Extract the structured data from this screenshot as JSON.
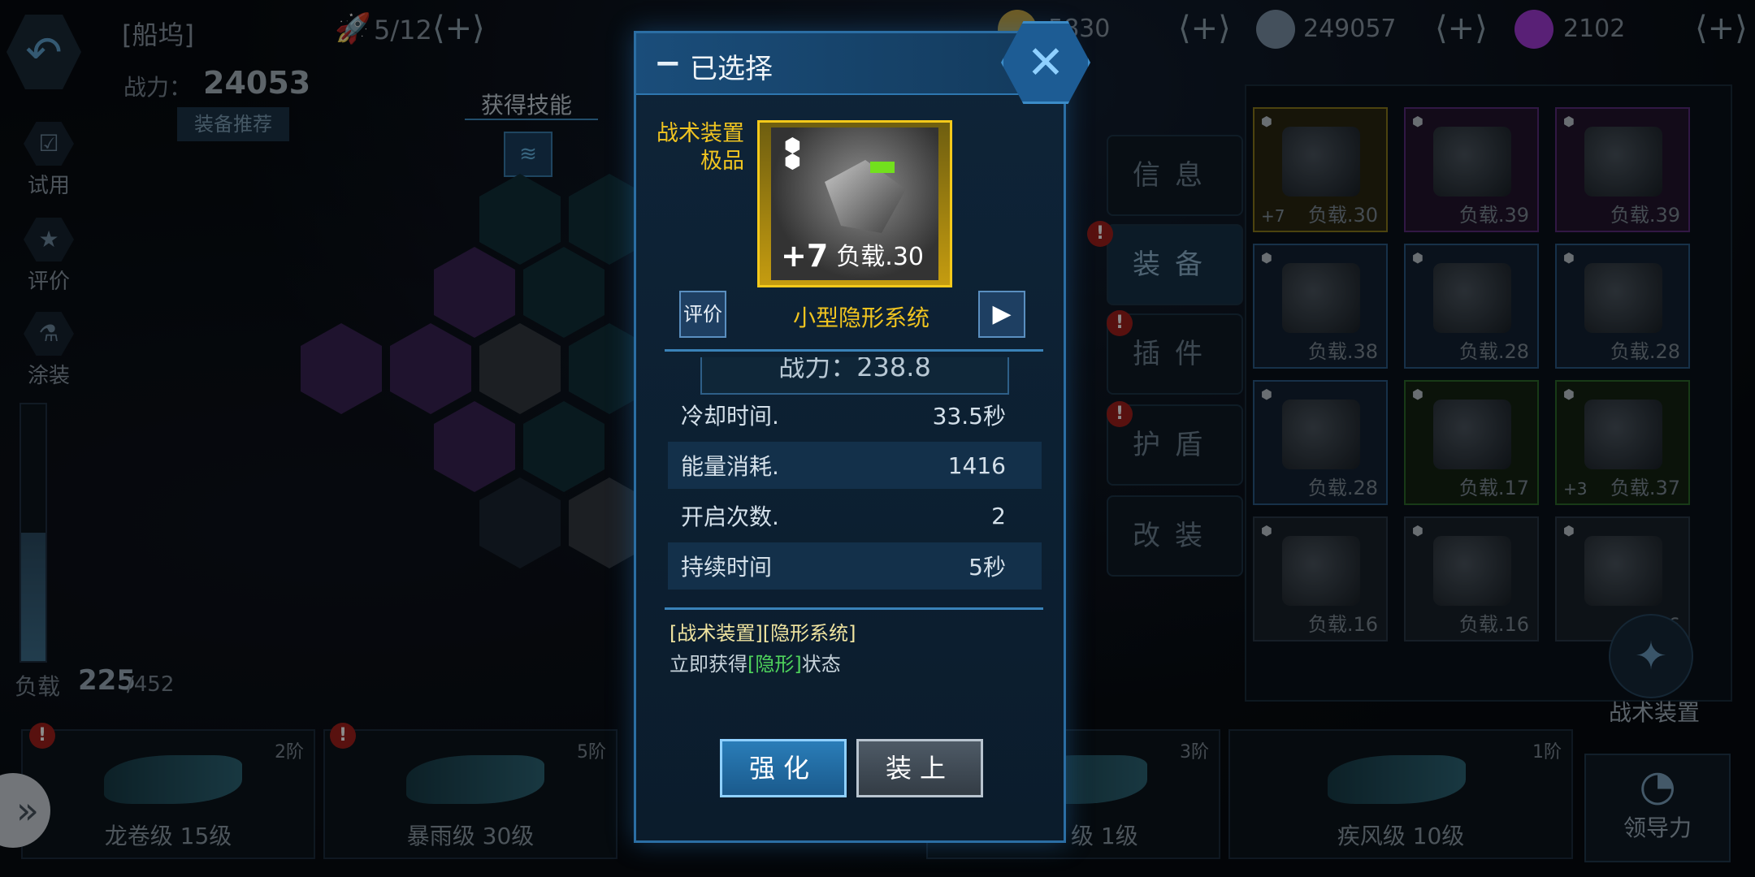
{
  "topbar": {
    "dock_title": "[船坞]",
    "slots": "5/12",
    "resources": [
      {
        "name": "credits",
        "value": "5830",
        "color": "#c9a640"
      },
      {
        "name": "alloy",
        "value": "249057",
        "color": "#7d93a8"
      },
      {
        "name": "crystal",
        "value": "2102",
        "color": "#a23bd8"
      }
    ]
  },
  "left": {
    "power_label": "战力：",
    "power_value": "24053",
    "recommend_label": "装备推荐",
    "side_items": [
      "试用",
      "评价",
      "涂装"
    ],
    "load_label": "负载",
    "load_value": "225",
    "load_max": "/452",
    "load_fraction": 0.5,
    "skill_label": "获得技能"
  },
  "modal": {
    "title": "已选择",
    "item_grade_line1": "战术装置",
    "item_grade_line2": "极品",
    "item_enhance": "+7",
    "item_load": "负载.30",
    "rate_label": "评价",
    "item_name": "小型隐形系统",
    "cp_text": "战力：238.8",
    "stats": [
      {
        "label": "冷却时间.",
        "value": "33.5秒"
      },
      {
        "label": "能量消耗.",
        "value": "1416"
      },
      {
        "label": "开启次数.",
        "value": "2"
      },
      {
        "label": "持续时间",
        "value": "5秒"
      }
    ],
    "desc_title": "[战术装置][隐形系统]",
    "desc_prefix": "立即获得",
    "desc_highlight": "[隐形]",
    "desc_suffix": "状态",
    "strengthen_label": "强化",
    "equip_label": "装上"
  },
  "menu": [
    "信息",
    "装备",
    "插件",
    "护盾",
    "改装"
  ],
  "grid": {
    "cards": [
      {
        "enh": "+7",
        "load": "负载.30",
        "color": "yellow"
      },
      {
        "enh": "",
        "load": "负载.39",
        "color": "purple"
      },
      {
        "enh": "",
        "load": "负载.39",
        "color": "purple"
      },
      {
        "enh": "",
        "load": "负载.38",
        "color": "blue"
      },
      {
        "enh": "",
        "load": "负载.28",
        "color": "blue"
      },
      {
        "enh": "",
        "load": "负载.28",
        "color": "blue"
      },
      {
        "enh": "",
        "load": "负载.28",
        "color": "blue"
      },
      {
        "enh": "",
        "load": "负载.17",
        "color": "green"
      },
      {
        "enh": "+3",
        "load": "负载.37",
        "color": "green"
      },
      {
        "enh": "",
        "load": "负载.16",
        "color": "gray"
      },
      {
        "enh": "",
        "load": "负载.16",
        "color": "gray"
      },
      {
        "enh": "",
        "load": ".16",
        "color": "gray"
      }
    ],
    "tactical_label": "战术装置"
  },
  "ships": [
    {
      "name": "龙卷级 15级",
      "tier": "2阶"
    },
    {
      "name": "暴雨级 30级",
      "tier": "5阶"
    },
    {
      "name": "级 1级",
      "tier": "3阶"
    },
    {
      "name": "疾风级 10级",
      "tier": "1阶"
    }
  ],
  "leadership_label": "领导力"
}
